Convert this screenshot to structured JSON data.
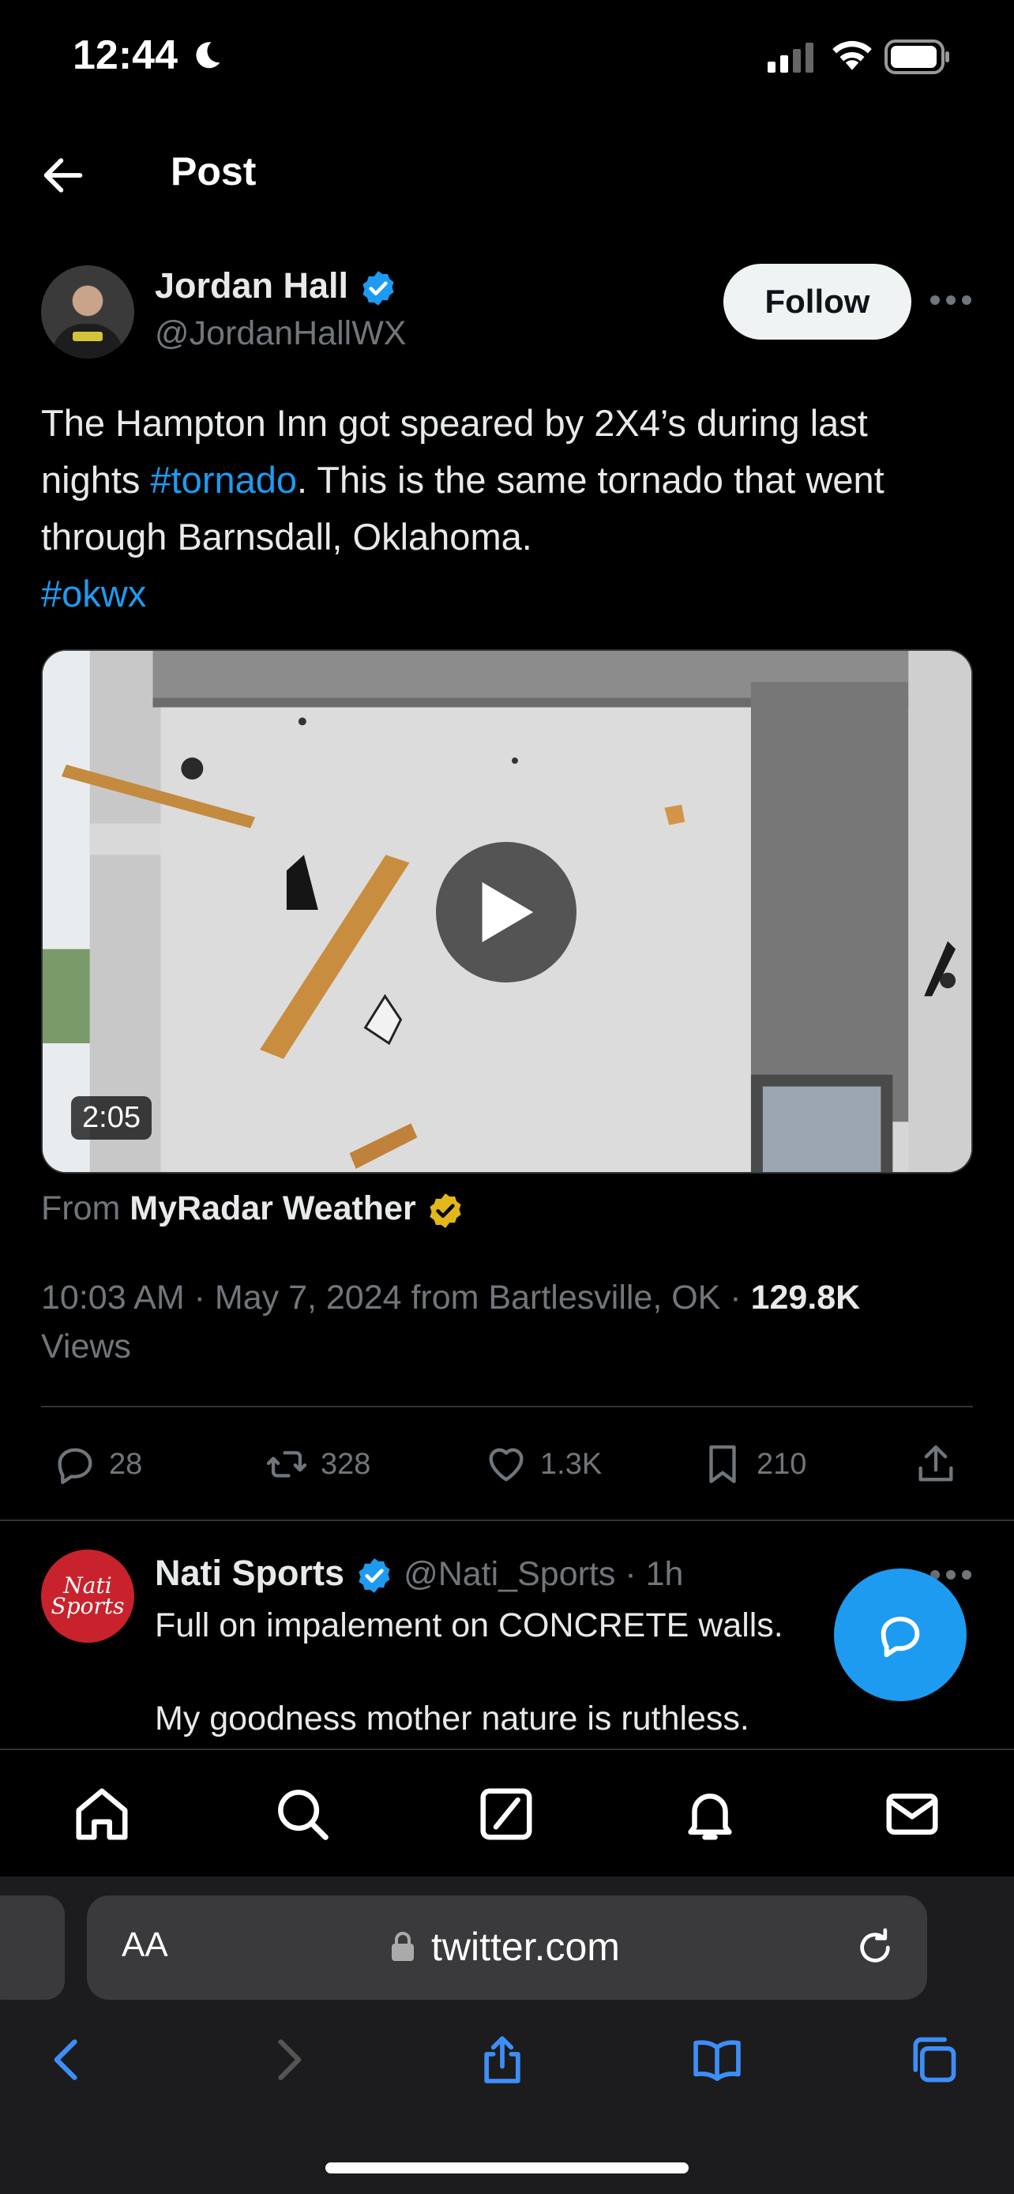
{
  "status_bar": {
    "time": "12:44"
  },
  "header": {
    "title": "Post"
  },
  "author": {
    "name": "Jordan Hall",
    "handle": "@JordanHallWX",
    "follow_label": "Follow"
  },
  "tweet": {
    "text_line1": "The Hampton Inn got speared by 2X4’s during last",
    "text_line2_pre": "nights ",
    "text_line2_tag": "#tornado",
    "text_line2_post": ". This is the same tornado that went",
    "text_line3": "through Barnsdall, Oklahoma.",
    "text_line4_tag": "#okwx",
    "video_duration": "2:05",
    "source_prefix": "From",
    "source_name": "MyRadar Weather",
    "meta_time": "10:03 AM · May 7, 2024 from Bartlesville, OK · ",
    "views_count": "129.8K",
    "views_label": "Views"
  },
  "actions": {
    "replies": "28",
    "reposts": "328",
    "likes": "1.3K",
    "bookmarks": "210"
  },
  "reply": {
    "avatar_text": "Nati Sports",
    "name": "Nati Sports",
    "handle_time": "@Nati_Sports · 1h",
    "line1": "Full on impalement on CONCRETE walls.",
    "line2": "My goodness mother nature is ruthless."
  },
  "browser": {
    "url": "twitter.com",
    "aa_label": "AA"
  },
  "colors": {
    "accent": "#1d9bf0",
    "gold_badge": "#e2b719",
    "background": "#000000"
  }
}
